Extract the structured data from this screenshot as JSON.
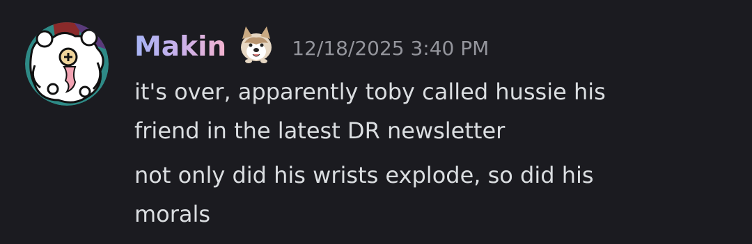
{
  "message": {
    "author": "Makin",
    "decoration_icon": "dog-emoji-icon",
    "avatar_icon": "avatar-icon",
    "timestamp": "12/18/2025 3:40 PM",
    "lines_group1": [
      "it's over, apparently toby called hussie his",
      "friend in the latest DR newsletter"
    ],
    "lines_group2": [
      "not only did his wrists explode, so did his",
      "morals"
    ]
  },
  "colors": {
    "background": "#1b1b20",
    "text": "#dbdee1",
    "timestamp": "#94959c",
    "name_gradient_start": "#a7b4f5",
    "name_gradient_end": "#f3b3cf"
  }
}
